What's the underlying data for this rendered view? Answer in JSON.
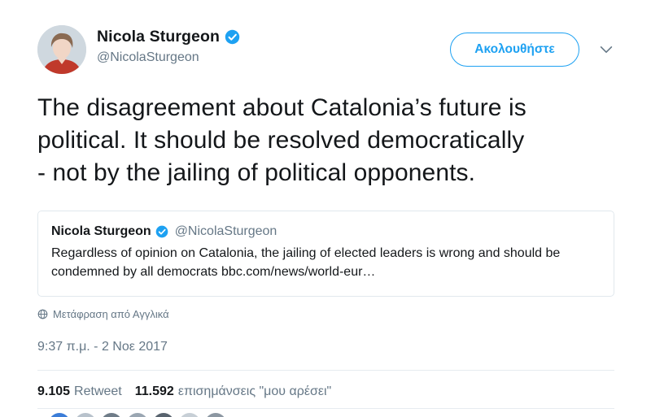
{
  "author": {
    "name": "Nicola Sturgeon",
    "handle": "@NicolaSturgeon"
  },
  "follow_button": "Ακολουθήστε",
  "tweet": {
    "line1": "The disagreement about Catalonia’s future is",
    "line2": "political. It should be resolved democratically",
    "line3": "- not by the jailing of political opponents."
  },
  "quote": {
    "name": "Nicola Sturgeon",
    "handle": "@NicolaSturgeon",
    "text": "Regardless of opinion on Catalonia, the jailing of elected leaders is wrong and should be condemned by all democrats",
    "link": "bbc.com/news/world-eur…"
  },
  "translate": "Μετάφραση από Αγγλικά",
  "timestamp": "9:37 π.μ. - 2 Νοε 2017",
  "stats": {
    "retweets_count": "9.105",
    "retweets_label": "Retweet",
    "likes_count": "11.592",
    "likes_label": "επισημάνσεις \"μου αρέσει\""
  },
  "colors": {
    "accent": "#1da1f2",
    "muted": "#657786",
    "text": "#14171a",
    "border": "#e1e8ed"
  },
  "icons": [
    "verified-badge-icon",
    "chevron-down-icon",
    "globe-icon"
  ]
}
